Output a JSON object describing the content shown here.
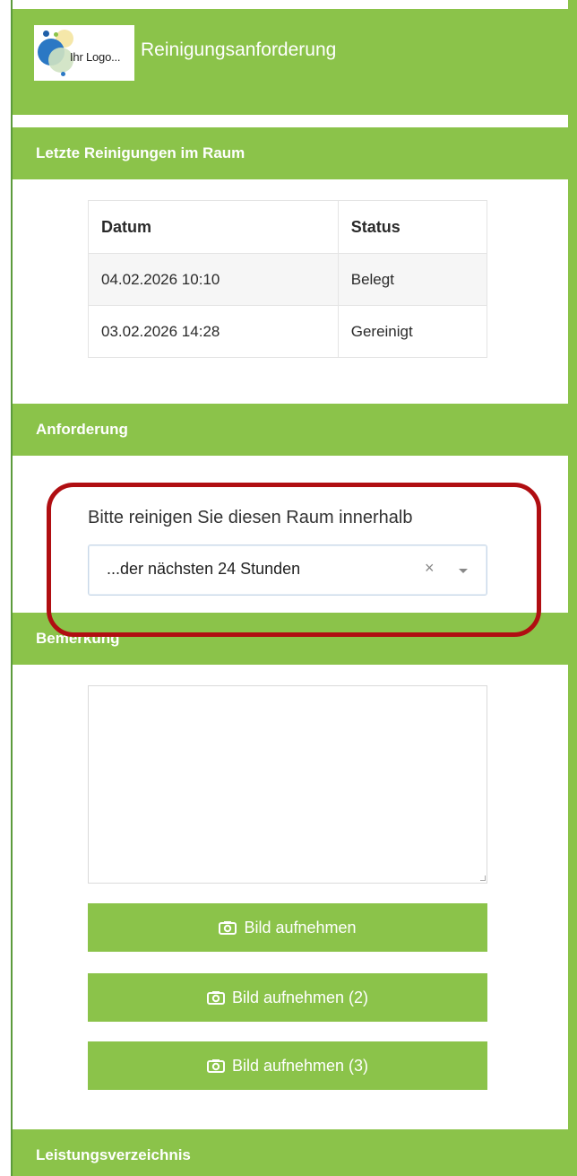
{
  "header": {
    "logo_text": "Ihr Logo...",
    "title": "Reinigungsanforderung"
  },
  "sections": {
    "last_cleanings": "Letzte Reinigungen im Raum",
    "request": "Anforderung",
    "remark": "Bemerkung",
    "services": "Leistungsverzeichnis"
  },
  "table": {
    "headers": [
      "Datum",
      "Status"
    ],
    "rows": [
      [
        "04.02.2026 10:10",
        "Belegt"
      ],
      [
        "03.02.2026 14:28",
        "Gereinigt"
      ]
    ]
  },
  "request": {
    "label": "Bitte reinigen Sie diesen Raum innerhalb",
    "selected": "...der nächsten 24 Stunden",
    "clear_symbol": "×"
  },
  "remark": {
    "value": ""
  },
  "buttons": [
    {
      "label": "Bild aufnehmen",
      "icon": "camera-icon"
    },
    {
      "label": "Bild aufnehmen (2)",
      "icon": "camera-icon"
    },
    {
      "label": "Bild aufnehmen (3)",
      "icon": "camera-icon"
    }
  ],
  "colors": {
    "primary": "#8bc34a",
    "highlight": "#b00e12"
  }
}
